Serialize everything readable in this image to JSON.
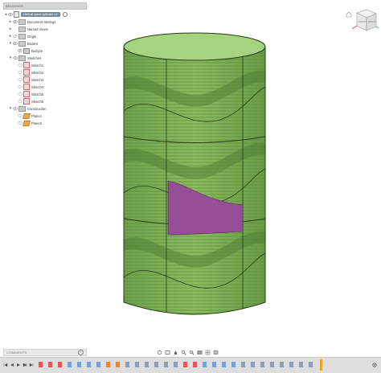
{
  "browser": {
    "title": "BROWSER",
    "root_label": "Helical wave cylinder v4",
    "items": [
      {
        "label": "Document Settings"
      },
      {
        "label": "Named Views"
      },
      {
        "label": "Origin"
      },
      {
        "label": "Bodies"
      },
      {
        "label": "Body2e"
      },
      {
        "label": "Sketches"
      },
      {
        "label": "Sketch1"
      },
      {
        "label": "Sketch2"
      },
      {
        "label": "Sketch3"
      },
      {
        "label": "Sketch4"
      },
      {
        "label": "Sketch5"
      },
      {
        "label": "Sketch6"
      },
      {
        "label": "Construction"
      },
      {
        "label": "Plane1"
      },
      {
        "label": "Plane2"
      }
    ]
  },
  "comments": {
    "label": "COMMENTS"
  },
  "viewcube": {
    "face_front": "FRONT",
    "face_right": "RIGHT"
  },
  "colors": {
    "body_green": "#7fb05a",
    "selected_face": "#9a4a9c",
    "marker": "#f0a020"
  },
  "icons": {
    "nav": [
      "orbit-icon",
      "pan-icon",
      "look-at-icon",
      "zoom-icon",
      "fit-icon",
      "display-settings-icon",
      "grid-icon",
      "viewports-icon"
    ],
    "timeline": [
      "to-start-icon",
      "previous-icon",
      "play-icon",
      "next-icon",
      "to-end-icon"
    ]
  }
}
